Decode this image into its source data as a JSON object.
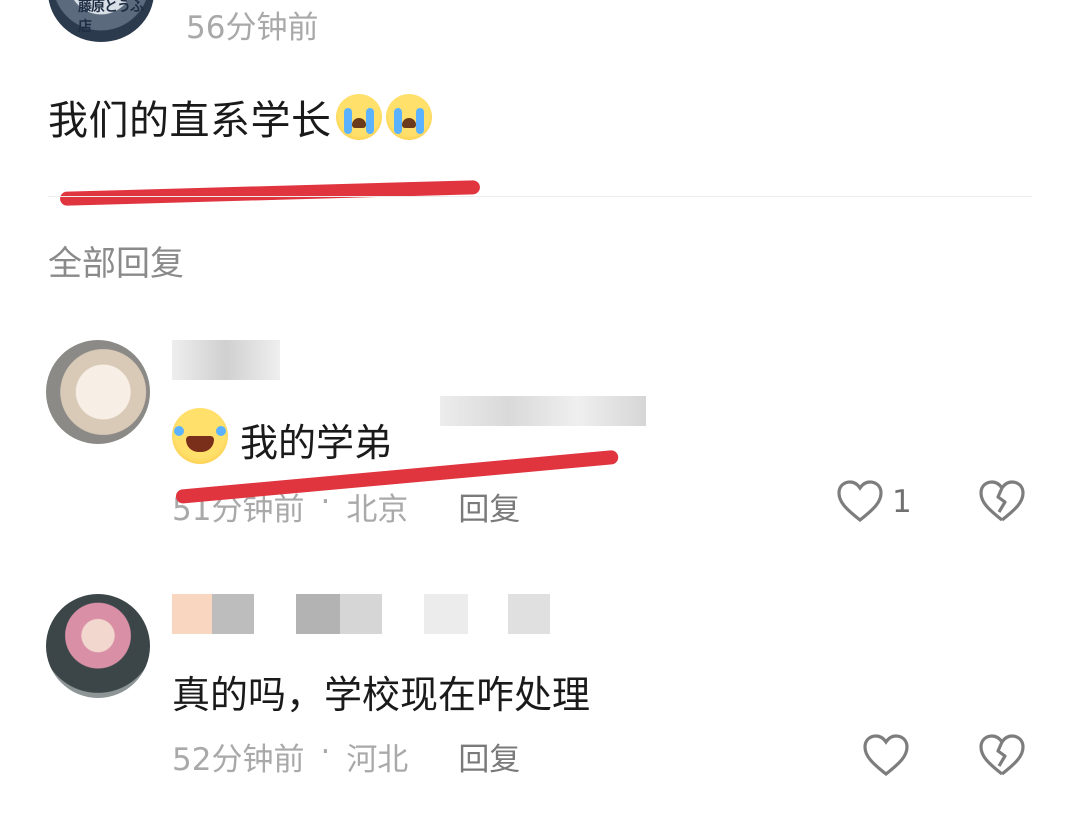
{
  "top_comment": {
    "time": "56分钟前",
    "avatar_tag": "藤原とうふ店",
    "text": "我们的直系学长"
  },
  "section": {
    "all_replies": "全部回复"
  },
  "replies": [
    {
      "text": "我的学弟",
      "time": "51分钟前",
      "location": "北京",
      "reply_label": "回复",
      "like_count": "1"
    },
    {
      "text": "真的吗，学校现在咋处理",
      "time": "52分钟前",
      "location": "河北",
      "reply_label": "回复",
      "like_count": ""
    }
  ],
  "meta_separator": "·",
  "colors": {
    "annotation_red": "#e0343f",
    "meta_gray": "#a9a9a9"
  },
  "icons": [
    "heart-icon",
    "broken-heart-icon",
    "loudly-crying-emoji",
    "rofl-emoji"
  ]
}
